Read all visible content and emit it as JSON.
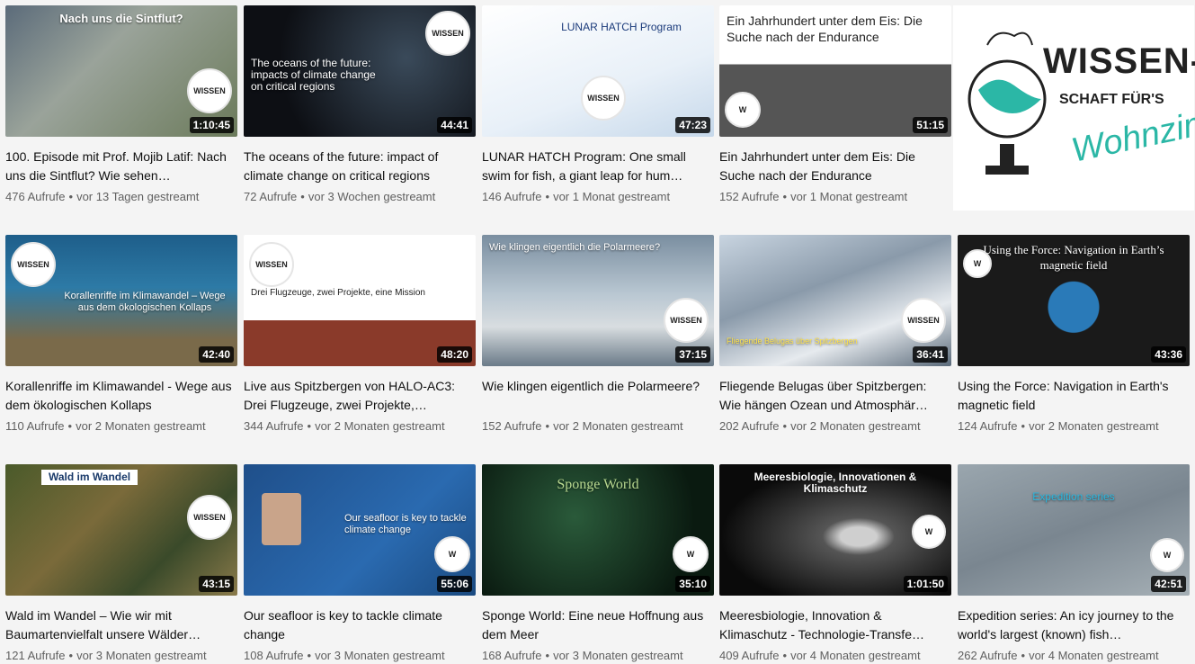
{
  "brand_panel": {
    "line1": "WISSEN-",
    "line2": "SCHAFT FÜR'S",
    "line3": "Wohnzimmer"
  },
  "videos": [
    {
      "title": "100. Episode mit Prof. Mojib Latif: Nach uns die Sintflut? Wie sehen…",
      "views": "476 Aufrufe",
      "when": "vor 13 Tagen gestreamt",
      "duration": "1:10:45",
      "thumb_text": "Nach uns die Sintflut?"
    },
    {
      "title": "The oceans of the future: impact of climate change on critical regions",
      "views": "72 Aufrufe",
      "when": "vor 3 Wochen gestreamt",
      "duration": "44:41",
      "thumb_text": "The oceans of the future: impacts of climate change on critical regions"
    },
    {
      "title": "LUNAR HATCH Program: One small swim for fish, a giant leap for hum…",
      "views": "146 Aufrufe",
      "when": "vor 1 Monat gestreamt",
      "duration": "47:23",
      "thumb_text": "LUNAR HATCH Program"
    },
    {
      "title": "Ein Jahrhundert unter dem Eis: Die Suche nach der Endurance",
      "views": "152 Aufrufe",
      "when": "vor 1 Monat gestreamt",
      "duration": "51:15",
      "thumb_text": "Ein Jahrhundert unter dem Eis: Die Suche nach der Endurance"
    },
    {
      "title": "Korallenriffe im Klimawandel - Wege aus dem ökologischen Kollaps",
      "views": "110 Aufrufe",
      "when": "vor 2 Monaten gestreamt",
      "duration": "42:40",
      "thumb_text": "Korallenriffe im Klimawandel – Wege aus dem ökologischen Kollaps"
    },
    {
      "title": "Live aus Spitzbergen von HALO-AC3: Drei Flugzeuge, zwei Projekte,…",
      "views": "344 Aufrufe",
      "when": "vor 2 Monaten gestreamt",
      "duration": "48:20",
      "thumb_text": "Drei Flugzeuge, zwei Projekte, eine Mission"
    },
    {
      "title": "Wie klingen eigentlich die Polarmeere?",
      "views": "152 Aufrufe",
      "when": "vor 2 Monaten gestreamt",
      "duration": "37:15",
      "thumb_text": "Wie klingen eigentlich die Polarmeere?"
    },
    {
      "title": "Fliegende Belugas über Spitzbergen: Wie hängen Ozean und Atmosphär…",
      "views": "202 Aufrufe",
      "when": "vor 2 Monaten gestreamt",
      "duration": "36:41",
      "thumb_text": "Fliegende Belugas über Spitzbergen"
    },
    {
      "title": "Using the Force: Navigation in Earth's magnetic field",
      "views": "124 Aufrufe",
      "when": "vor 2 Monaten gestreamt",
      "duration": "43:36",
      "thumb_text": "Using the Force: Navigation in Earth’s magnetic field"
    },
    {
      "title": "Wald im Wandel – Wie wir mit Baumartenvielfalt unsere Wälder…",
      "views": "121 Aufrufe",
      "when": "vor 3 Monaten gestreamt",
      "duration": "43:15",
      "thumb_text": "Wald im Wandel"
    },
    {
      "title": "Our seafloor is key to tackle climate change",
      "views": "108 Aufrufe",
      "when": "vor 3 Monaten gestreamt",
      "duration": "55:06",
      "thumb_text": "Our seafloor is key to tackle climate change"
    },
    {
      "title": "Sponge World: Eine neue Hoffnung aus dem Meer",
      "views": "168 Aufrufe",
      "when": "vor 3 Monaten gestreamt",
      "duration": "35:10",
      "thumb_text": "Sponge World"
    },
    {
      "title": "Meeresbiologie, Innovation & Klimaschutz - Technologie-Transfe…",
      "views": "409 Aufrufe",
      "when": "vor 4 Monaten gestreamt",
      "duration": "1:01:50",
      "thumb_text": "Meeresbiologie, Innovationen & Klimaschutz"
    },
    {
      "title": "Expedition series: An icy journey to the world's largest (known) fish…",
      "views": "262 Aufrufe",
      "when": "vor 4 Monaten gestreamt",
      "duration": "42:51",
      "thumb_text": "Expedition series"
    }
  ],
  "colors": {
    "duration_bg": "#000000",
    "meta_text": "#606060",
    "title_text": "#0f0f0f",
    "accent": "#2bb7a6"
  }
}
